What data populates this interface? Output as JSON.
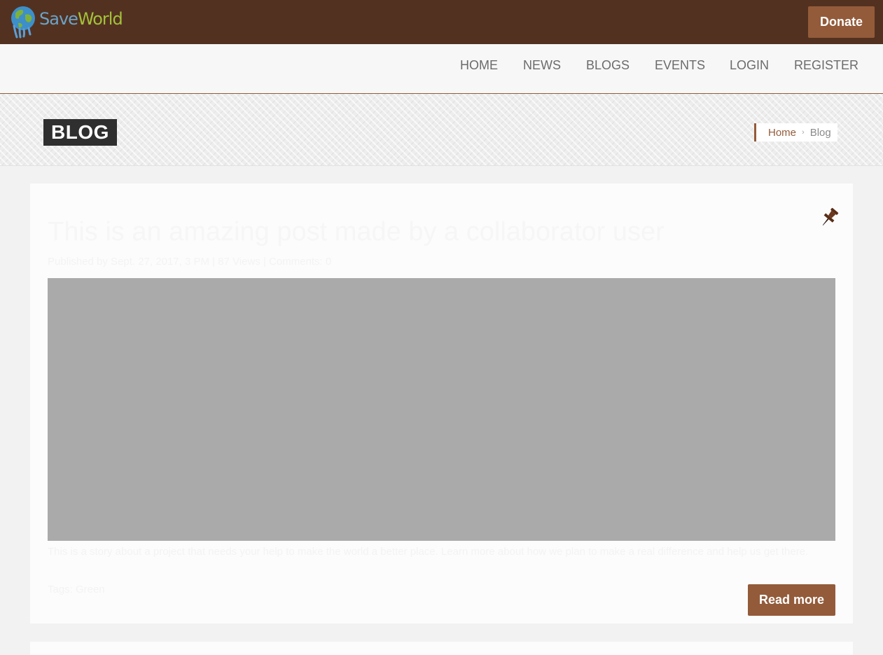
{
  "header": {
    "logo": {
      "part1": "Save",
      "part2": "World",
      "icon": "globe-icon"
    },
    "donate_label": "Donate"
  },
  "nav": {
    "items": [
      {
        "label": "HOME"
      },
      {
        "label": "NEWS"
      },
      {
        "label": "BLOGS"
      },
      {
        "label": "EVENTS"
      },
      {
        "label": "LOGIN"
      },
      {
        "label": "REGISTER"
      }
    ]
  },
  "page": {
    "title": "BLOG",
    "breadcrumb": {
      "home": "Home",
      "separator": "›",
      "current": "Blog"
    }
  },
  "post": {
    "pinned_icon": "pushpin-icon",
    "title": "This is an amazing post made by a collaborator user",
    "meta": "Published by Sept. 27, 2017, 3 PM | 87 Views | Comments: 0",
    "excerpt": "This is a story about a project that needs your help to make the world a better place. Learn more about how we plan to make a real difference and help us get there.",
    "tags": "Tags: Green",
    "read_more_label": "Read more"
  },
  "colors": {
    "topbar": "#533120",
    "accent": "#935b3a",
    "navbar": "#f7f7f7",
    "title_badge": "#2f2f2f",
    "image_placeholder": "#aaaaaa"
  }
}
